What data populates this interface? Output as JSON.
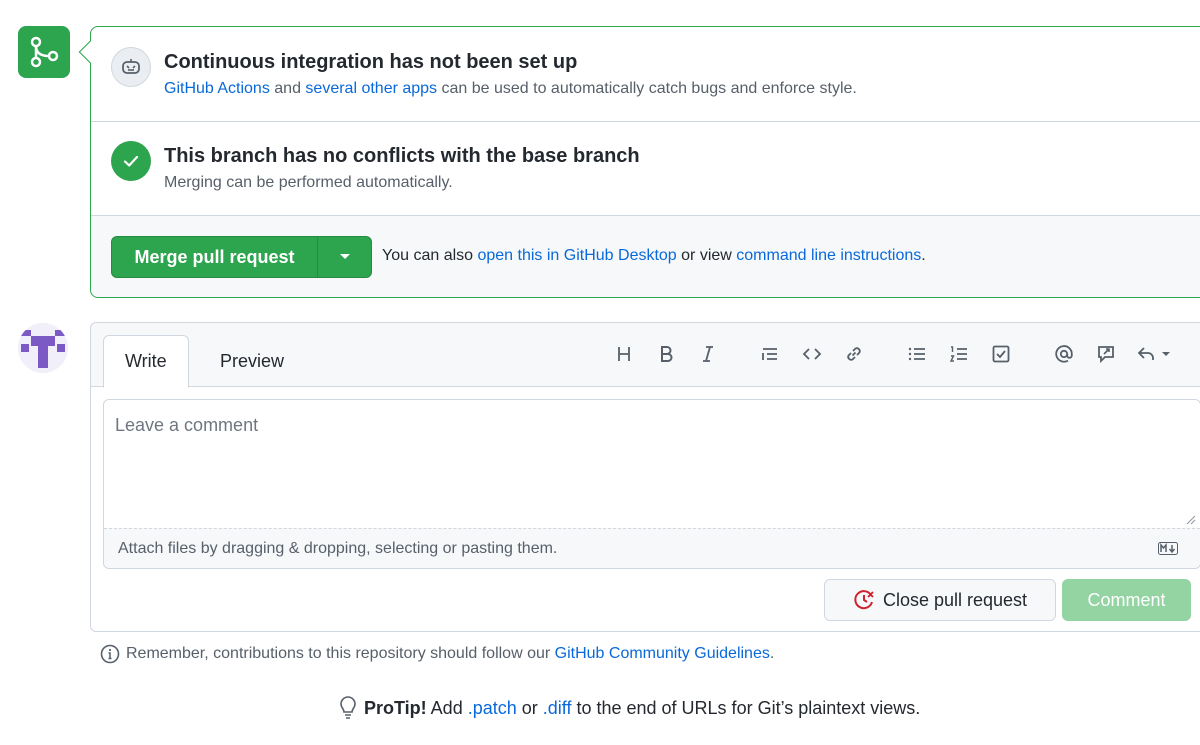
{
  "ci": {
    "title": "Continuous integration has not been set up",
    "link1": "GitHub Actions",
    "mid": " and ",
    "link2": "several other apps",
    "rest": " can be used to automatically catch bugs and enforce style."
  },
  "conflicts": {
    "title": "This branch has no conflicts with the base branch",
    "subtitle": "Merging can be performed automatically."
  },
  "merge": {
    "button_label": "Merge pull request",
    "also_prefix": "You can also ",
    "desktop_link": "open this in GitHub Desktop",
    "or_view": " or view ",
    "cli_link": "command line instructions",
    "period": "."
  },
  "editor": {
    "tabs": [
      "Write",
      "Preview"
    ],
    "active_tab": "Write",
    "toolbar": [
      "heading-icon",
      "bold-icon",
      "italic-icon",
      "quote-icon",
      "code-icon",
      "link-icon",
      "unordered-list-icon",
      "ordered-list-icon",
      "task-list-icon",
      "mention-icon",
      "reference-icon",
      "saved-replies-icon"
    ],
    "placeholder": "Leave a comment",
    "attach_text": "Attach files by dragging & dropping, selecting or pasting them."
  },
  "actions": {
    "close_label": "Close pull request",
    "comment_label": "Comment"
  },
  "footer": {
    "remember_prefix": "Remember, contributions to this repository should follow our ",
    "guidelines_link": "GitHub Community Guidelines",
    "remember_suffix": ".",
    "protip_bold": "ProTip!",
    "protip_add": " Add ",
    "patch": ".patch",
    "or": " or ",
    "diff": ".diff",
    "protip_rest": " to the end of URLs for Git’s plaintext views."
  },
  "colors": {
    "green": "#2da44e",
    "link_blue": "#0969da",
    "close_red": "#cf222e",
    "disabled_green": "#94d3a2",
    "avatar_purple": "#7b5ac6"
  }
}
